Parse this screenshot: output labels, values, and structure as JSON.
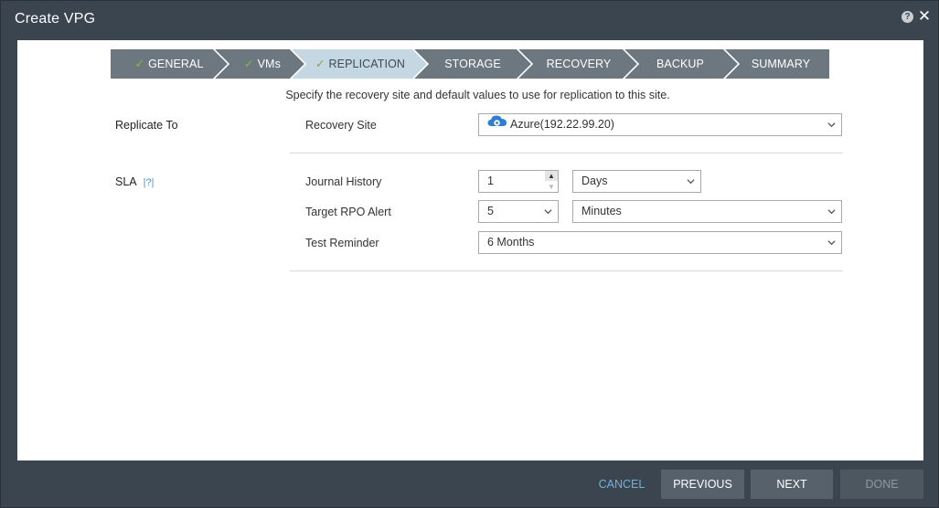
{
  "window": {
    "title": "Create VPG"
  },
  "steps": [
    {
      "label": "GENERAL",
      "done": true
    },
    {
      "label": "VMs",
      "done": true
    },
    {
      "label": "REPLICATION",
      "done": true,
      "active": true
    },
    {
      "label": "STORAGE",
      "done": false
    },
    {
      "label": "RECOVERY",
      "done": false
    },
    {
      "label": "BACKUP",
      "done": false
    },
    {
      "label": "SUMMARY",
      "done": false
    }
  ],
  "subtitle": "Specify the recovery site and default values to use for replication to this site.",
  "replicate_to": {
    "section_label": "Replicate To",
    "recovery_site_label": "Recovery Site",
    "recovery_site_value": "Azure(192.22.99.20)",
    "recovery_site_icon": "azure-cloud-icon"
  },
  "sla": {
    "section_label": "SLA",
    "help_text": "|?|",
    "journal_history_label": "Journal History",
    "journal_history_value": "1",
    "journal_history_unit": "Days",
    "target_rpo_label": "Target RPO Alert",
    "target_rpo_value": "5",
    "target_rpo_unit": "Minutes",
    "test_reminder_label": "Test Reminder",
    "test_reminder_value": "6 Months"
  },
  "footer": {
    "cancel": "CANCEL",
    "previous": "PREVIOUS",
    "next": "NEXT",
    "done": "DONE"
  },
  "colors": {
    "frame": "#3b4550",
    "step_inactive": "#6d7780",
    "step_active": "#c6d7e4",
    "check": "#7ac142",
    "link": "#6fb3d6"
  }
}
